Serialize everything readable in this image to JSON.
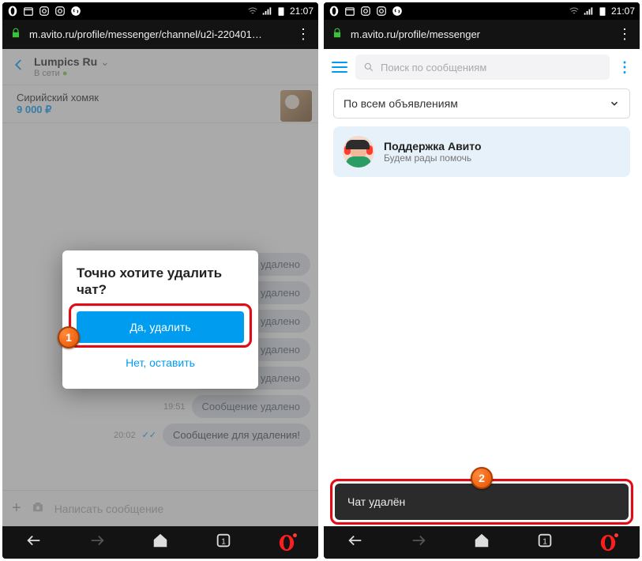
{
  "status": {
    "time": "21:07"
  },
  "left": {
    "url": "m.avito.ru/profile/messenger/channel/u2i-220401…",
    "chat": {
      "name": "Lumpics Ru",
      "status": "В сети",
      "listing_name": "Сирийский хомяк",
      "listing_price": "9 000 ₽"
    },
    "messages": {
      "deleted_label": "Сообщение удалено",
      "t1": "19:51",
      "t2": "19:51",
      "t3": "19:51",
      "t4": "20:02",
      "last": "Сообщение для удаления!"
    },
    "composer": {
      "placeholder": "Написать сообщение"
    },
    "modal": {
      "title": "Точно хотите удалить чат?",
      "confirm": "Да, удалить",
      "cancel": "Нет, оставить"
    },
    "badge": "1"
  },
  "right": {
    "url": "m.avito.ru/profile/messenger",
    "search_placeholder": "Поиск по сообщениям",
    "filter_label": "По всем объявлениям",
    "support": {
      "title": "Поддержка Авито",
      "sub": "Будем рады помочь"
    },
    "toast": "Чат удалён",
    "badge": "2"
  }
}
